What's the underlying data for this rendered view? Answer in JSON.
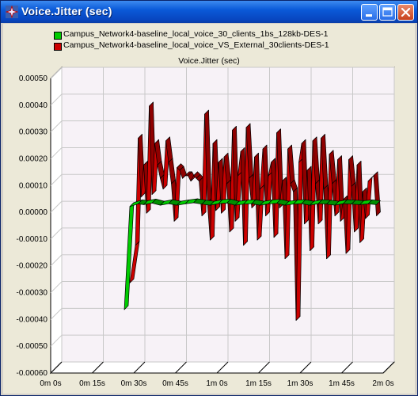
{
  "window": {
    "title": "Voice.Jitter (sec)",
    "title_color": "#ffffff",
    "titlebar_color": "#0a5ad8"
  },
  "icons": {
    "app": "network-star-icon",
    "minimize": "minimize-icon",
    "maximize": "maximize-icon",
    "close": "close-icon"
  },
  "chart_data": {
    "type": "line",
    "title": "Voice.Jitter (sec)",
    "xlabel": "",
    "ylabel": "",
    "xlim": [
      0,
      120
    ],
    "ylim": [
      -0.0006,
      0.0005
    ],
    "grid": true,
    "legend_position": "top",
    "y_ticks": [
      "0.00050",
      "0.00040",
      "0.00030",
      "0.00020",
      "0.00010",
      "0.00000",
      "-0.00010",
      "-0.00020",
      "-0.00030",
      "-0.00040",
      "-0.00050",
      "-0.00060"
    ],
    "x_ticks": [
      "0m 0s",
      "0m 15s",
      "0m 30s",
      "0m 45s",
      "1m 0s",
      "1m 15s",
      "1m 30s",
      "1m 45s",
      "2m 0s"
    ],
    "series": [
      {
        "name": "Campus_Network4-baseline_local_voice_30_clients_1bs_128kb-DES-1",
        "color": "#00cc00",
        "x": [
          24,
          26,
          29,
          31,
          34,
          37,
          40,
          43,
          46,
          49,
          52,
          55,
          58,
          61,
          64,
          67,
          70,
          73,
          76,
          79,
          82,
          85,
          88,
          91,
          94,
          97,
          100,
          103,
          106,
          109,
          112,
          115
        ],
        "y": [
          -0.00039,
          -5e-06,
          5e-06,
          2e-06,
          8e-06,
          0.0,
          6e-06,
          0.0,
          5e-06,
          9e-06,
          4e-06,
          0.0,
          6e-06,
          8e-06,
          0.0,
          4e-06,
          6e-06,
          0.0,
          5e-06,
          7e-06,
          0.0,
          4e-06,
          6e-06,
          0.0,
          6e-06,
          4e-06,
          0.0,
          6e-06,
          4e-06,
          2e-06,
          5e-06,
          2e-06
        ]
      },
      {
        "name": "Campus_Network4-baseline_local_voice_VS_External_30clients-DES-1",
        "color": "#cc0000",
        "x": [
          26,
          28,
          29,
          30,
          31,
          32,
          33,
          34,
          35,
          36,
          37,
          38,
          39,
          40,
          41,
          42,
          43,
          44,
          45,
          46,
          47,
          48,
          49,
          50,
          51,
          52,
          53,
          54,
          55,
          56,
          57,
          58,
          59,
          60,
          61,
          62,
          63,
          64,
          65,
          66,
          67,
          68,
          69,
          70,
          71,
          72,
          73,
          74,
          75,
          76,
          77,
          78,
          79,
          80,
          81,
          82,
          83,
          84,
          85,
          86,
          87,
          88,
          89,
          90,
          91,
          92,
          93,
          94,
          95,
          96,
          97,
          98,
          99,
          100,
          101,
          102,
          103,
          104,
          105,
          106,
          107,
          108,
          109,
          110,
          111,
          112,
          113,
          114,
          115
        ],
        "y": [
          -0.00029,
          -0.00015,
          0.00025,
          3e-05,
          0.00015,
          -3e-05,
          0.00037,
          4e-05,
          0.00023,
          0.00015,
          0.0001,
          6e-05,
          0.00024,
          0.00016,
          8e-05,
          -6e-05,
          0.00014,
          0.00013,
          0.0001,
          0.00011,
          0.00011,
          9e-05,
          0.00011,
          0.0001,
          9e-05,
          -4e-05,
          0.00034,
          1e-05,
          -0.00013,
          0.00023,
          -2e-05,
          0.00016,
          -3e-05,
          0.00018,
          8e-05,
          -0.0001,
          0.00028,
          -6e-05,
          0.00011,
          0.0002,
          -0.00015,
          0.00029,
          0.0001,
          -1e-05,
          0.00018,
          -0.00013,
          6e-05,
          0.00021,
          -4e-05,
          0.00011,
          0.00016,
          -0.00012,
          0.00027,
          -1e-05,
          9e-05,
          -0.0002,
          0.00021,
          8e-05,
          5e-05,
          -0.00043,
          0.00016,
          0.00023,
          -7e-05,
          0.00013,
          -0.00017,
          0.00024,
          8e-05,
          -7e-05,
          0.00025,
          6e-05,
          -0.0002,
          0.00019,
          8e-05,
          -4e-05,
          0.00017,
          -6e-05,
          2e-05,
          -0.00018,
          0.00017,
          7e-05,
          -0.0001,
          0.00015,
          -0.00014,
          5e-05,
          -5e-05,
          9e-05,
          0.0001,
          0.00011,
          -4e-05
        ]
      }
    ]
  }
}
